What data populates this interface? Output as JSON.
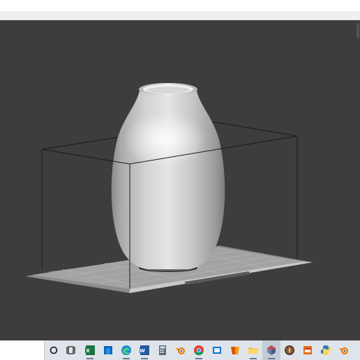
{
  "viewport": {
    "background": "#3e3d3b",
    "object": "vase-model",
    "build_volume": "wireframe-box",
    "build_plate": "grid-plate"
  },
  "taskbar": {
    "background": "#dfe4ea",
    "search_placeholder": "",
    "icons": [
      {
        "name": "cortana-icon",
        "active": false
      },
      {
        "name": "task-view-icon",
        "active": false
      },
      {
        "name": "excel-icon",
        "active": false
      },
      {
        "name": "file-explorer-blue-icon",
        "active": false
      },
      {
        "name": "edge-icon",
        "active": false
      },
      {
        "name": "word-icon",
        "active": false
      },
      {
        "name": "calculator-icon",
        "active": false
      },
      {
        "name": "blender-icon",
        "active": false
      },
      {
        "name": "chrome-icon",
        "active": false
      },
      {
        "name": "window-app-icon",
        "active": false
      },
      {
        "name": "shield-app-icon",
        "active": false
      },
      {
        "name": "folder-icon",
        "active": false
      },
      {
        "name": "3d-slicer-icon",
        "active": true
      },
      {
        "name": "compass-app-icon",
        "active": false
      },
      {
        "name": "toolbox-app-icon",
        "active": false
      },
      {
        "name": "python-icon",
        "active": false
      },
      {
        "name": "blender-2-icon",
        "active": false
      }
    ]
  }
}
